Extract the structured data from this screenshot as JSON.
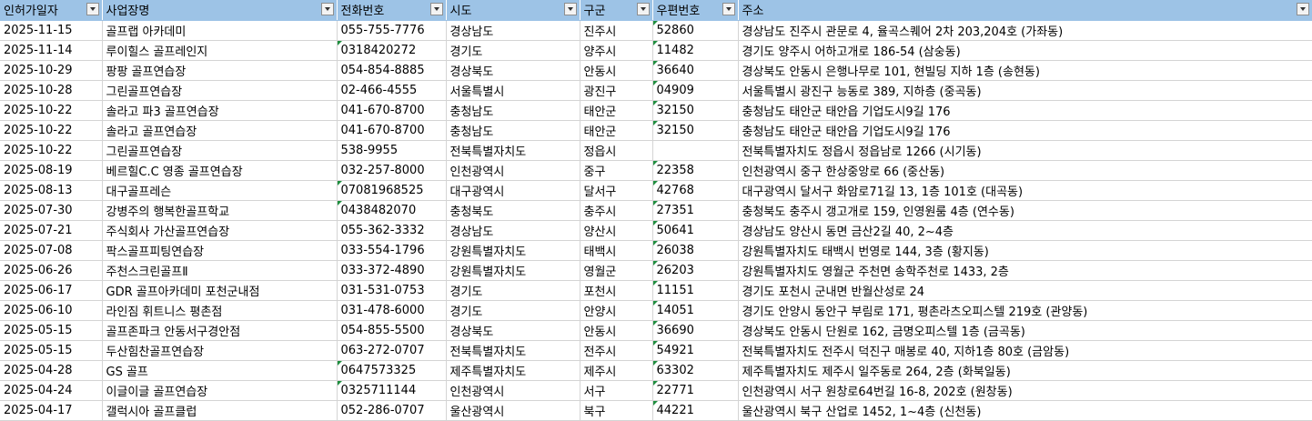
{
  "columns": [
    "인허가일자",
    "사업장명",
    "전화번호",
    "시도",
    "구군",
    "우편번호",
    "주소"
  ],
  "rows": [
    [
      "2025-11-15",
      "골프랩 아카데미",
      "055-755-7776",
      "경상남도",
      "진주시",
      "52860",
      "경상남도 진주시 관문로 4, 율곡스퀘어 2차 203,204호 (가좌동)"
    ],
    [
      "2025-11-14",
      "루이힐스 골프레인지",
      "0318420272",
      "경기도",
      "양주시",
      "11482",
      "경기도 양주시 어하고개로 186-54 (삼숭동)"
    ],
    [
      "2025-10-29",
      "팡팡 골프연습장",
      "054-854-8885",
      "경상북도",
      "안동시",
      "36640",
      "경상북도 안동시 은행나무로 101, 현빌딩 지하 1층 (송현동)"
    ],
    [
      "2025-10-28",
      "그린골프연습장",
      "02-466-4555",
      "서울특별시",
      "광진구",
      "04909",
      "서울특별시 광진구 능동로 389, 지하층 (중곡동)"
    ],
    [
      "2025-10-22",
      "솔라고 파3 골프연습장",
      "041-670-8700",
      "충청남도",
      "태안군",
      "32150",
      "충청남도 태안군 태안읍 기업도시9길 176"
    ],
    [
      "2025-10-22",
      "솔라고 골프연습장",
      "041-670-8700",
      "충청남도",
      "태안군",
      "32150",
      "충청남도 태안군 태안읍 기업도시9길 176"
    ],
    [
      "2025-10-22",
      "그린골프연습장",
      "538-9955",
      "전북특별자치도",
      "정읍시",
      "",
      "전북특별자치도 정읍시 정읍남로 1266 (시기동)"
    ],
    [
      "2025-08-19",
      "베르힐C.C 영종 골프연습장",
      "032-257-8000",
      "인천광역시",
      "중구",
      "22358",
      "인천광역시 중구 한상중앙로 66 (중산동)"
    ],
    [
      "2025-08-13",
      "대구골프레슨",
      "07081968525",
      "대구광역시",
      "달서구",
      "42768",
      "대구광역시 달서구 화암로71길 13, 1층 101호 (대곡동)"
    ],
    [
      "2025-07-30",
      "강병주의 행복한골프학교",
      "0438482070",
      "충청북도",
      "충주시",
      "27351",
      "충청북도 충주시 갱고개로 159, 인영원룸 4층 (연수동)"
    ],
    [
      "2025-07-21",
      "주식회사 가산골프연습장",
      "055-362-3332",
      "경상남도",
      "양산시",
      "50641",
      "경상남도 양산시 동면 금산2길 40, 2~4층"
    ],
    [
      "2025-07-08",
      "팍스골프피팅연습장",
      "033-554-1796",
      "강원특별자치도",
      "태백시",
      "26038",
      "강원특별자치도 태백시 번영로 144, 3층 (황지동)"
    ],
    [
      "2025-06-26",
      "주천스크린골프Ⅱ",
      "033-372-4890",
      "강원특별자치도",
      "영월군",
      "26203",
      "강원특별자치도 영월군 주천면 송학주천로 1433, 2층"
    ],
    [
      "2025-06-17",
      "GDR 골프아카데미 포천군내점",
      "031-531-0753",
      "경기도",
      "포천시",
      "11151",
      "경기도 포천시 군내면 반월산성로 24"
    ],
    [
      "2025-06-10",
      "라인짐 휘트니스 평촌점",
      "031-478-6000",
      "경기도",
      "안양시",
      "14051",
      "경기도 안양시 동안구 부림로 171, 평촌라츠오피스텔 219호 (관양동)"
    ],
    [
      "2025-05-15",
      "골프존파크 안동서구경안점",
      "054-855-5500",
      "경상북도",
      "안동시",
      "36690",
      "경상북도 안동시 단원로 162, 금명오피스텔 1층 (금곡동)"
    ],
    [
      "2025-05-15",
      "두산힘찬골프연습장",
      "063-272-0707",
      "전북특별자치도",
      "전주시",
      "54921",
      "전북특별자치도 전주시 덕진구 매봉로 40, 지하1층 80호 (금암동)"
    ],
    [
      "2025-04-28",
      "GS 골프",
      "0647573325",
      "제주특별자치도",
      "제주시",
      "63302",
      "제주특별자치도 제주시 일주동로 264, 2층 (화북일동)"
    ],
    [
      "2025-04-24",
      "이글이글 골프연습장",
      "0325711144",
      "인천광역시",
      "서구",
      "22771",
      "인천광역시 서구 원창로64번길 16-8, 202호 (원창동)"
    ],
    [
      "2025-04-17",
      "갤럭시아 골프클럽",
      "052-286-0707",
      "울산광역시",
      "북구",
      "44221",
      "울산광역시 북구 산업로 1452, 1~4층 (신천동)"
    ]
  ],
  "text_number_columns": [
    2,
    5
  ],
  "colors": {
    "header_bg": "#9dc3e6",
    "grid": "#d4d4d4",
    "error_flag": "#1e8e3e"
  }
}
